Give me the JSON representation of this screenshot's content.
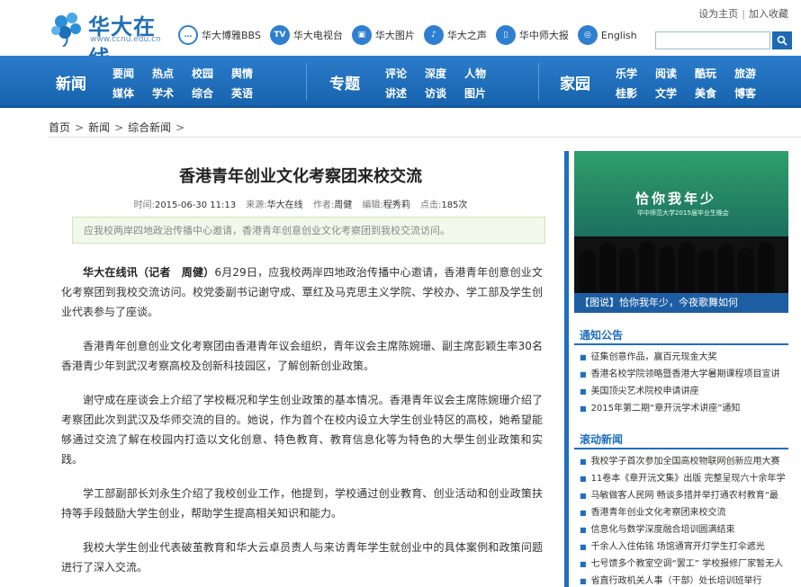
{
  "header": {
    "logo_text": "华大在线",
    "logo_url": "www.ccnu.edu.cn",
    "top_links": [
      {
        "icon": "chat-bubble-icon",
        "label": "华大博雅BBS"
      },
      {
        "icon": "tv-icon",
        "label": "华大电视台"
      },
      {
        "icon": "picture-icon",
        "label": "华大图片"
      },
      {
        "icon": "radio-icon",
        "label": "华大之声"
      },
      {
        "icon": "newspaper-icon",
        "label": "华中师大报"
      },
      {
        "icon": "globe-icon",
        "label": "English"
      }
    ],
    "util_links": [
      "设为主页",
      "加入收藏"
    ],
    "search": {
      "value": "",
      "placeholder": ""
    }
  },
  "nav": {
    "sections": [
      {
        "title": "新闻",
        "items": [
          "要闻",
          "媒体",
          "热点",
          "学术",
          "校园",
          "综合",
          "舆情",
          "英语"
        ]
      },
      {
        "title": "专题",
        "items": [
          "评论",
          "讲述",
          "深度",
          "访谈",
          "人物",
          "图片"
        ]
      },
      {
        "title": "家园",
        "items": [
          "乐学",
          "桂影",
          "阅读",
          "文学",
          "酷玩",
          "美食",
          "旅游",
          "博客"
        ]
      }
    ]
  },
  "breadcrumb": [
    "首页",
    "新闻",
    "综合新闻"
  ],
  "article": {
    "title": "香港青年创业文化考察团来校交流",
    "meta": {
      "time_label": "时间:",
      "time": "2015-06-30 11:13",
      "source_label": "来源:",
      "source": "华大在线",
      "author_label": "作者:",
      "author": "周健",
      "editor_label": "编辑:",
      "editor": "程秀莉",
      "clicks_label": "点击:",
      "clicks": "185次"
    },
    "summary": "应我校两岸四地政治传播中心邀请，香港青年创意创业文化考察团到我校交流访问。",
    "lead_bold": "华大在线讯（记者　周健）",
    "paragraphs": [
      "6月29日，应我校两岸四地政治传播中心邀请，香港青年创意创业文化考察团到我校交流访问。校党委副书记谢守成、覃红及马克思主义学院、学校办、学工部及学生创业代表参与了座谈。",
      "香港青年创意创业文化考察团由香港青年议会组织，青年议会主席陈婉珊、副主席彭颖生率30名香港青少年到武汉考察高校及创新科技园区，了解创新创业政策。",
      "谢守成在座谈会上介绍了学校概况和学生创业政策的基本情况。香港青年议会主席陈婉珊介绍了考察团此次到武汉及华师交流的目的。她说，作为首个在校内设立大学生创业特区的高校，她希望能够通过交流了解在校园内打造以文化创意、特色教育、教育信息化等为特色的大學生创业政策和实践。",
      "学工部副部长刘永生介绍了我校创业工作，他提到，学校通过创业教育、创业活动和创业政策扶持等手段鼓励大学生创业，帮助学生提高相关知识和能力。",
      "我校大学生创业代表破茧教育和华大云卓员责人与来访青年学生就创业中的具体案例和政策问题进行了深入交流。"
    ]
  },
  "sidebar": {
    "photo_banner": "恰你我年少",
    "photo_sub": "华中师范大学2015届毕业生晚会",
    "photo_caption": "【图说】恰你我年少，今夜歌舞如何",
    "notice": {
      "title": "通知公告",
      "items": [
        "征集创意作品，赢百元现金大奖",
        "香港名校学院领略暨香港大学暑期课程项目宣讲",
        "美国顶尖艺术院校申请讲座",
        "2015年第二期“章开沅学术讲座”通知"
      ]
    },
    "rolling": {
      "title": "滚动新闻",
      "items": [
        "我校学子首次参加全国高校物联网创新应用大赛",
        "11卷本《章开沅文集》出版 完整呈现六十余年学",
        "马敏做客人民网 畅谈多措并举打通农村教育“最",
        "香港青年创业文化考察团来校交流",
        "信息化与数学深度融合培训圆满结束",
        "千余人入住佑铭 场馆通宵开灯学生打伞遮光",
        "七号馈多个教室空调“罢工” 学校报修厂家暂无人",
        "省直行政机关人事（干部）处长培训班举行"
      ]
    }
  },
  "colors": {
    "brand_blue": "#1e6fbf",
    "nav_blue": "#1f6fbe",
    "summary_bg": "#f2f8ea"
  }
}
